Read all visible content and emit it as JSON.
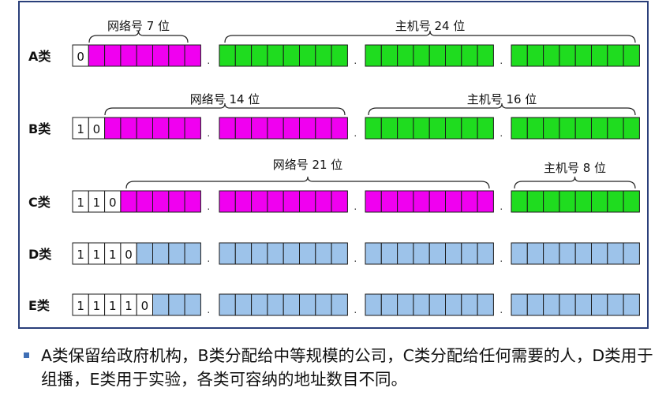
{
  "colors": {
    "network": "#f000f0",
    "host": "#1fdc1f",
    "reserved": "#9dc3ea",
    "frame_border": "#2a3f7a",
    "bullet": "#3f6fb5"
  },
  "classes": [
    {
      "label": "A类",
      "prefix": [
        "0"
      ],
      "fills": [
        "network",
        "host",
        "host",
        "host"
      ],
      "braces": [
        {
          "label": "网络号 7 位"
        },
        {
          "label": "主机号 24 位"
        }
      ]
    },
    {
      "label": "B类",
      "prefix": [
        "1",
        "0"
      ],
      "fills": [
        "network",
        "network",
        "host",
        "host"
      ],
      "braces": [
        {
          "label": "网络号 14 位"
        },
        {
          "label": "主机号 16 位"
        }
      ]
    },
    {
      "label": "C类",
      "prefix": [
        "1",
        "1",
        "0"
      ],
      "fills": [
        "network",
        "network",
        "network",
        "host"
      ],
      "braces": [
        {
          "label": "网络号 21 位"
        },
        {
          "label": "主机号 8 位"
        }
      ]
    },
    {
      "label": "D类",
      "prefix": [
        "1",
        "1",
        "1",
        "0"
      ],
      "fills": [
        "reserved",
        "reserved",
        "reserved",
        "reserved"
      ],
      "braces": []
    },
    {
      "label": "E类",
      "prefix": [
        "1",
        "1",
        "1",
        "1",
        "0"
      ],
      "fills": [
        "reserved",
        "reserved",
        "reserved",
        "reserved"
      ],
      "braces": []
    }
  ],
  "separator": ".",
  "caption": "A类保留给政府机构，B类分配给中等规模的公司，C类分配给任何需要的人，D类用于组播，E类用于实验，各类可容纳的地址数目不同。"
}
